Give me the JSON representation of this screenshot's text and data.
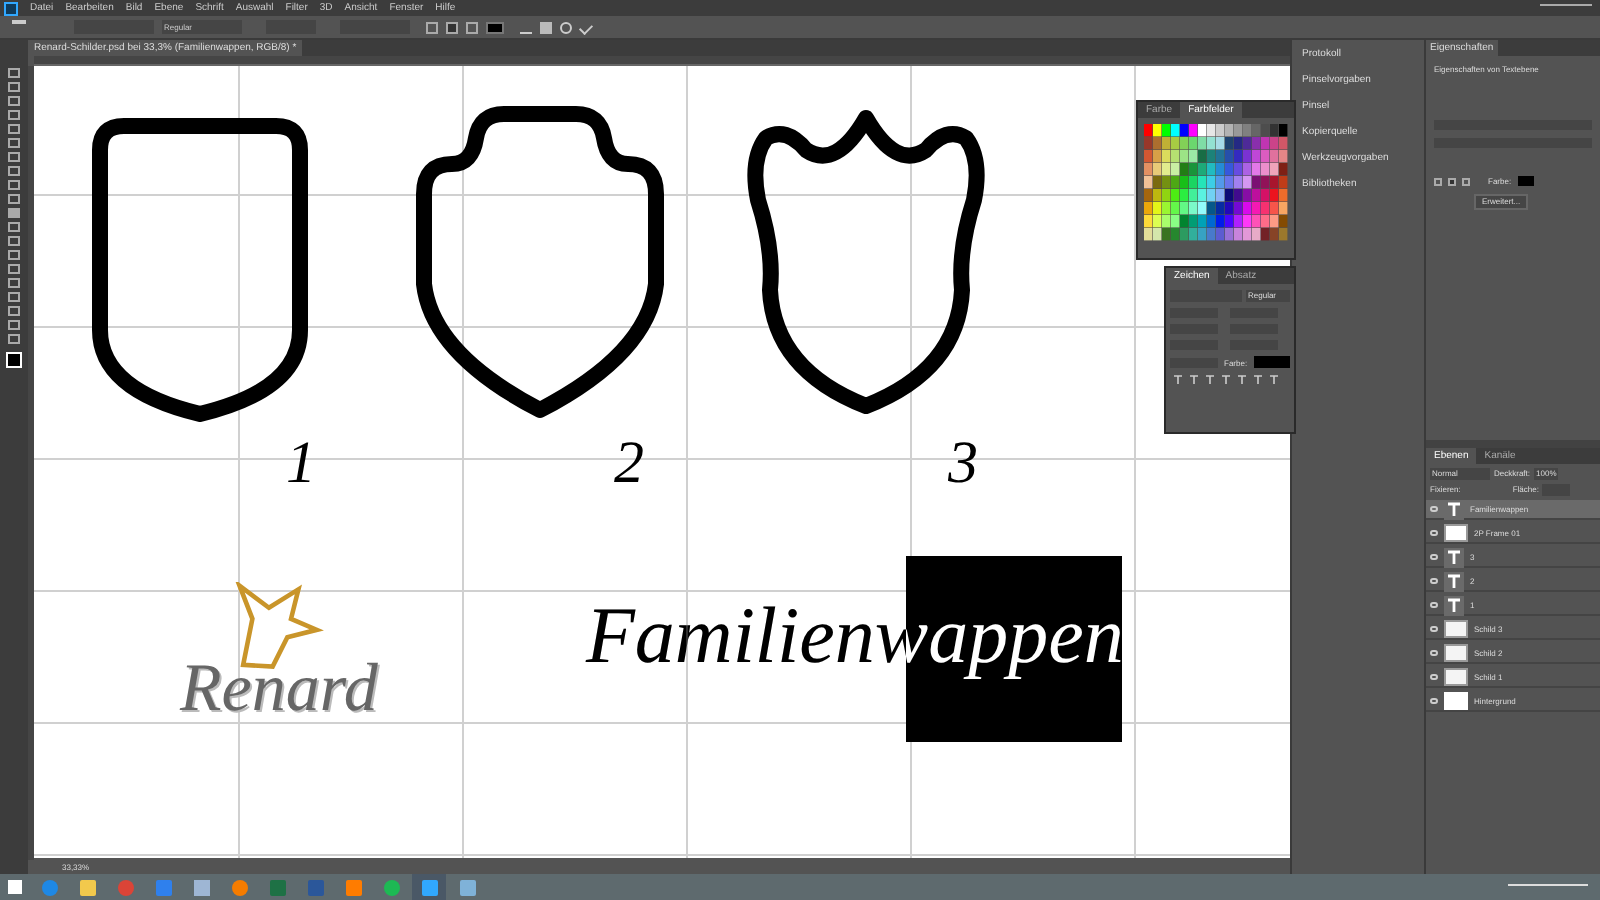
{
  "menu_bar": {
    "items": [
      "Datei",
      "Bearbeiten",
      "Bild",
      "Ebene",
      "Schrift",
      "Auswahl",
      "Filter",
      "3D",
      "Ansicht",
      "Fenster",
      "Hilfe"
    ]
  },
  "options_bar": {
    "font_style": "Regular"
  },
  "document_tab": {
    "title": "Renard-Schilder.psd bei 33,3% (Familienwappen, RGB/8) *"
  },
  "canvas": {
    "shields": [
      {
        "label": "1"
      },
      {
        "label": "2"
      },
      {
        "label": "3"
      }
    ],
    "logo": {
      "text": "Renard"
    },
    "title": {
      "text": "Familienwappen"
    }
  },
  "swatches_panel": {
    "tabs": [
      {
        "label": "Farbe",
        "selected": false
      },
      {
        "label": "Farbfelder",
        "selected": true
      }
    ]
  },
  "character_panel": {
    "tabs": [
      {
        "label": "Zeichen",
        "selected": true
      },
      {
        "label": "Absatz",
        "selected": false
      }
    ],
    "font_style": "Regular",
    "color_label": "Farbe:"
  },
  "dock": {
    "items": [
      "Protokoll",
      "Pinselvorgaben",
      "Pinsel",
      "Kopierquelle",
      "Werkzeugvorgaben",
      "Bibliotheken"
    ]
  },
  "properties": {
    "title": "Eigenschaften",
    "subtitle": "Eigenschaften von Textebene",
    "color_label": "Farbe:",
    "button": "Erweitert..."
  },
  "layers": {
    "tabs": [
      {
        "label": "Ebenen",
        "selected": true
      },
      {
        "label": "Kanäle",
        "selected": false
      }
    ],
    "blend_mode": "Normal",
    "opacity_label": "Deckkraft:",
    "opacity": "100%",
    "lock_label": "Fixieren:",
    "fill_label": "Fläche:",
    "items": [
      {
        "name": "Familienwappen",
        "kind": "text",
        "selected": true
      },
      {
        "name": "2P Frame 01",
        "kind": "image",
        "selected": false
      },
      {
        "name": "3",
        "kind": "text",
        "selected": false
      },
      {
        "name": "2",
        "kind": "text",
        "selected": false
      },
      {
        "name": "1",
        "kind": "text",
        "selected": false
      },
      {
        "name": "Schild 3",
        "kind": "shape",
        "selected": false
      },
      {
        "name": "Schild 2",
        "kind": "shape",
        "selected": false
      },
      {
        "name": "Schild 1",
        "kind": "shape",
        "selected": false
      },
      {
        "name": "Hintergrund",
        "kind": "background",
        "selected": false
      }
    ]
  },
  "status_bar": {
    "zoom": "33,33%"
  },
  "taskbar": {
    "apps": [
      {
        "kind": "browser",
        "color": "#1e88e5"
      },
      {
        "kind": "folder",
        "color": "#f2c94c"
      },
      {
        "kind": "round",
        "color": "#db4437"
      },
      {
        "kind": "app",
        "color": "#2f80ed"
      },
      {
        "kind": "doc",
        "color": "#9eb6d4"
      },
      {
        "kind": "round",
        "color": "#f57c00"
      },
      {
        "kind": "app",
        "color": "#1e7145"
      },
      {
        "kind": "app",
        "color": "#2b579a"
      },
      {
        "kind": "app",
        "color": "#ff7c00"
      },
      {
        "kind": "round",
        "color": "#1db954"
      },
      {
        "kind": "app",
        "color": "#31a8ff"
      },
      {
        "kind": "app",
        "color": "#7fb2d8"
      }
    ]
  }
}
